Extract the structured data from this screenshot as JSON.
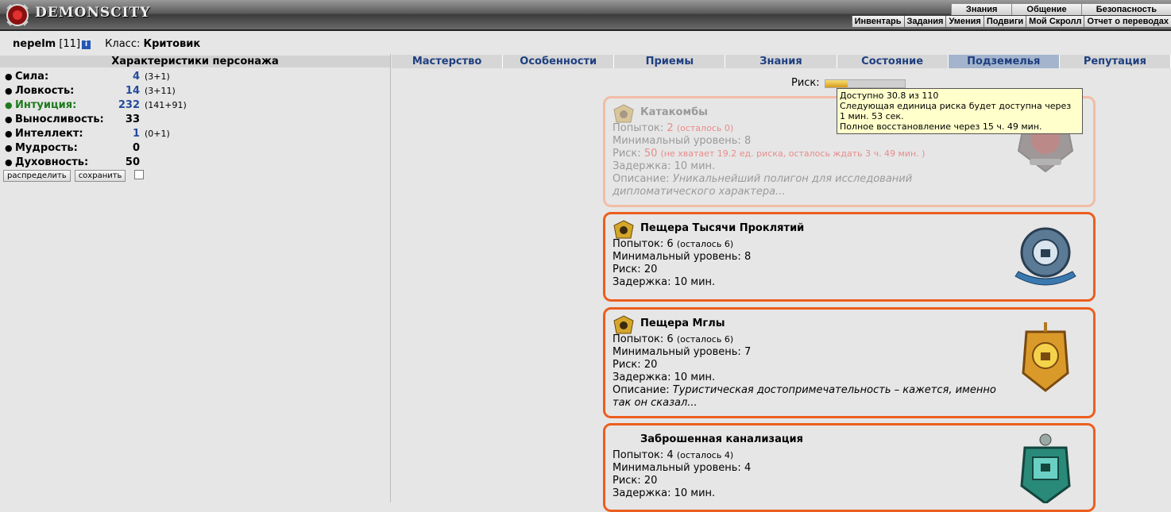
{
  "header": {
    "logo_text": "DEMONSCITY",
    "nav_upper": [
      "Знания",
      "Общение",
      "Безопасность"
    ],
    "nav_lower": [
      "Инвентарь",
      "Задания",
      "Умения",
      "Подвиги",
      "Мой Скролл",
      "Отчет о переводах"
    ]
  },
  "player": {
    "nick": "nepelm",
    "level": "[11]",
    "info_badge": "i",
    "class_label": "Класс:",
    "class_value": "Критовик"
  },
  "stats_panel": {
    "title": "Характеристики персонажа",
    "stats": [
      {
        "name": "Сила:",
        "value": "4",
        "bonus": "(3+1)"
      },
      {
        "name": "Ловкость:",
        "value": "14",
        "bonus": "(3+11)"
      },
      {
        "name": "Интуиция:",
        "value": "232",
        "bonus": "(141+91)"
      },
      {
        "name": "Выносливость:",
        "value": "33",
        "bonus": ""
      },
      {
        "name": "Интеллект:",
        "value": "1",
        "bonus": "(0+1)"
      },
      {
        "name": "Мудрость:",
        "value": "0",
        "bonus": ""
      },
      {
        "name": "Духовность:",
        "value": "50",
        "bonus": ""
      }
    ],
    "distribute_label": "распределить",
    "save_label": "сохранить"
  },
  "tabs": [
    "Мастерство",
    "Особенности",
    "Приемы",
    "Знания",
    "Состояние",
    "Подземелья",
    "Репутация"
  ],
  "active_tab": "Подземелья",
  "risk": {
    "label": "Риск:",
    "fraction": 0.28,
    "tooltip": {
      "line1": "Доступно 30.8 из 110",
      "line2": "Следующая единица риска будет доступна через",
      "line3": "1 мин. 53 сек.",
      "line4": "Полное восстановление через 15 ч. 49 мин."
    }
  },
  "dungeons": [
    {
      "title": "Катакомбы",
      "attempts_label": "Попыток:",
      "attempts": "2",
      "attempts_left": "(осталось 0)",
      "min_level_label": "Минимальный уровень:",
      "min_level": "8",
      "risk_label": "Риск:",
      "risk": "50",
      "risk_note": "(не хватает 19.2 ед. риска, осталось ждать 3 ч. 49 мин. )",
      "delay_label": "Задержка:",
      "delay": "10 мин.",
      "desc_label": "Описание:",
      "desc_1": "Уникальнейший полигон для исследований",
      "desc_2": "дипломатического характера..."
    },
    {
      "title": "Пещера Тысячи Проклятий",
      "attempts_label": "Попыток:",
      "attempts": "6",
      "attempts_left": "(осталось 6)",
      "min_level_label": "Минимальный уровень:",
      "min_level": "8",
      "risk_label": "Риск:",
      "risk": "20",
      "delay_label": "Задержка:",
      "delay": "10 мин."
    },
    {
      "title": "Пещера Мглы",
      "attempts_label": "Попыток:",
      "attempts": "6",
      "attempts_left": "(осталось 6)",
      "min_level_label": "Минимальный уровень:",
      "min_level": "7",
      "risk_label": "Риск:",
      "risk": "20",
      "delay_label": "Задержка:",
      "delay": "10 мин.",
      "desc_label": "Описание:",
      "desc_1": "Туристическая достопримечательность – кажется, именно",
      "desc_2": "так он сказал..."
    },
    {
      "title": "Заброшенная канализация",
      "attempts_label": "Попыток:",
      "attempts": "4",
      "attempts_left": "(осталось 4)",
      "min_level_label": "Минимальный уровень:",
      "min_level": "4",
      "risk_label": "Риск:",
      "risk": "20",
      "delay_label": "Задержка:",
      "delay": "10 мин."
    }
  ],
  "colors": {
    "card_border": "#ec5e1e",
    "active_tab": "#a3b4cc",
    "tab_text": "#1e3f80",
    "stat_blue": "#244b9c",
    "stat_green": "#1e7a1e"
  }
}
